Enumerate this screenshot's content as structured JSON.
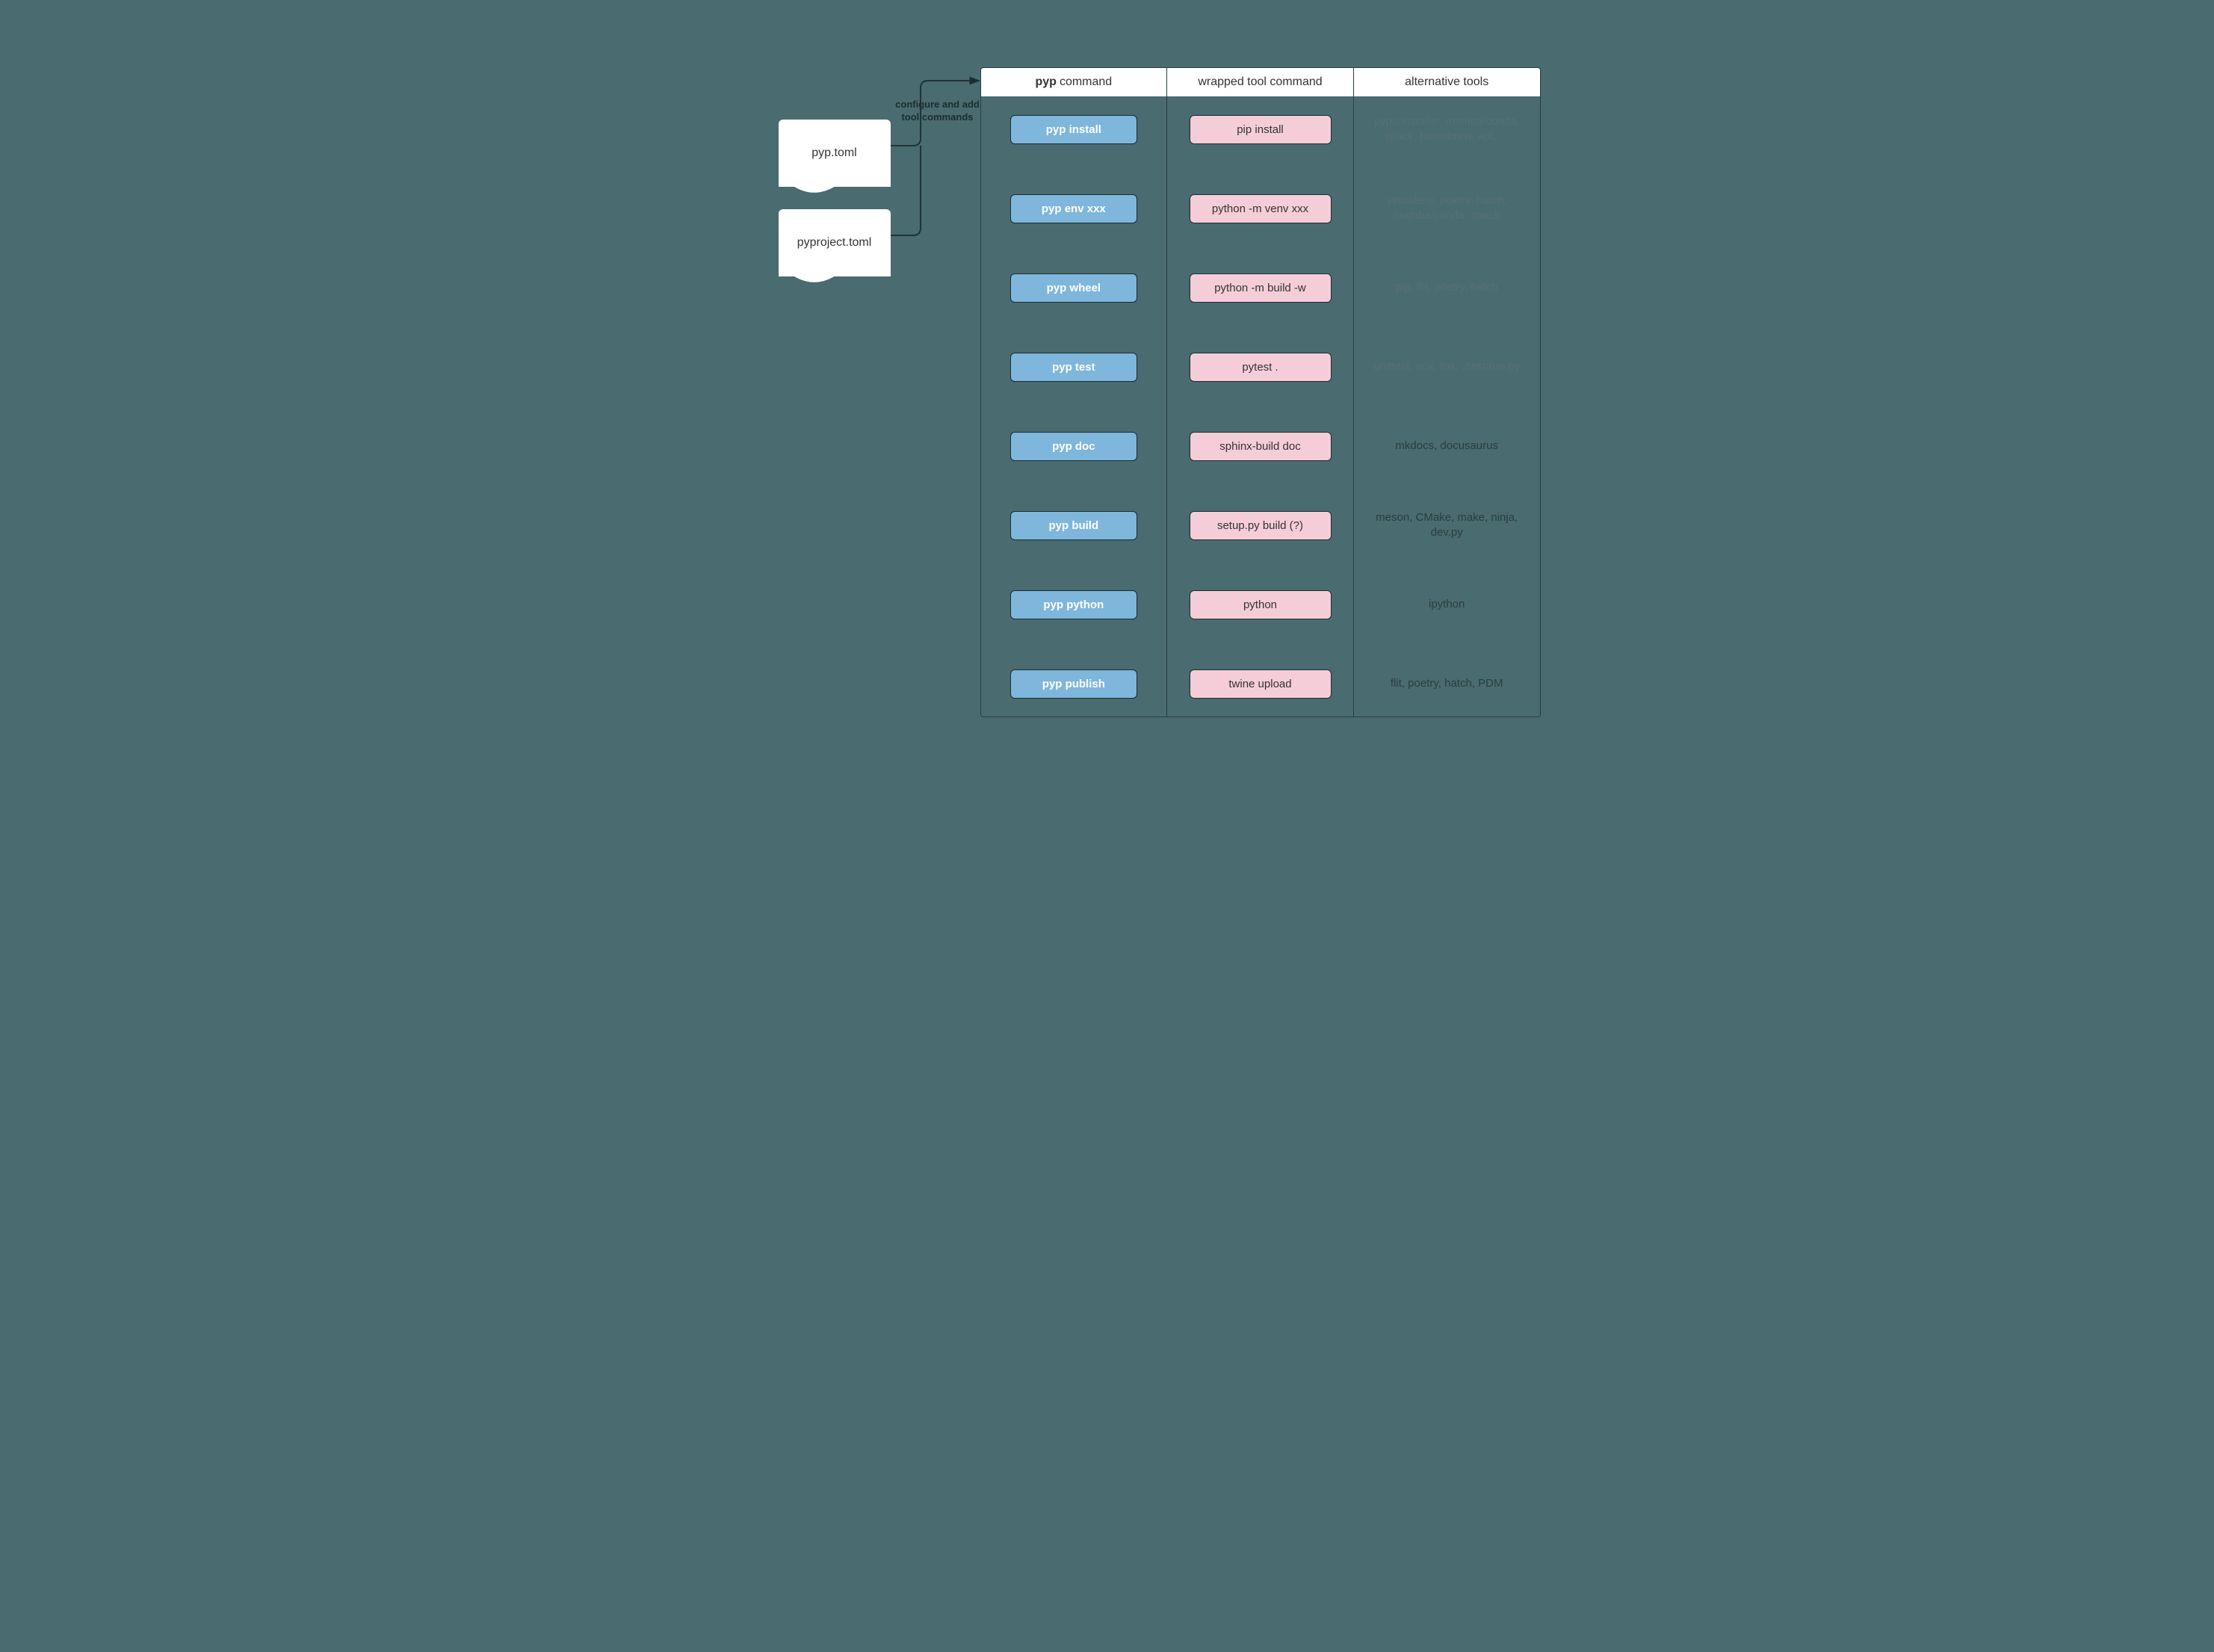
{
  "files": {
    "pyp_toml": "pyp.toml",
    "pyproject_toml": "pyproject.toml"
  },
  "connector_label": "configure and add\ntool commands",
  "headers": {
    "col1_bold": "pyp",
    "col1_rest": " command",
    "col2": "wrapped tool command",
    "col3": "alternative tools"
  },
  "rows": [
    {
      "pyp": "pyp install",
      "wrapped": "pip install",
      "alt": "pypa/installer, mamba/conda, spack, homebrew, apt, ...",
      "alt_class": "faded1"
    },
    {
      "pyp": "pyp env xxx",
      "wrapped": "python -m venv xxx",
      "alt": "virtualenv, poetry, hatch, mamba/conda, spack",
      "alt_class": "faded2"
    },
    {
      "pyp": "pyp wheel",
      "wrapped": "python -m build -w",
      "alt": "pip, flit, poetry, hatch",
      "alt_class": "faded3"
    },
    {
      "pyp": "pyp test",
      "wrapped": "pytest .",
      "alt": "unittest, nox, tox, ./test/run.py",
      "alt_class": "faded4"
    },
    {
      "pyp": "pyp doc",
      "wrapped": "sphinx-build doc",
      "alt": "mkdocs, docusaurus",
      "alt_class": ""
    },
    {
      "pyp": "pyp build",
      "wrapped": "setup.py build (?)",
      "alt": "meson, CMake, make, ninja, dev.py",
      "alt_class": ""
    },
    {
      "pyp": "pyp python",
      "wrapped": "python",
      "alt": "ipython",
      "alt_class": ""
    },
    {
      "pyp": "pyp publish",
      "wrapped": "twine upload",
      "alt": "flit, poetry, hatch, PDM",
      "alt_class": ""
    }
  ]
}
